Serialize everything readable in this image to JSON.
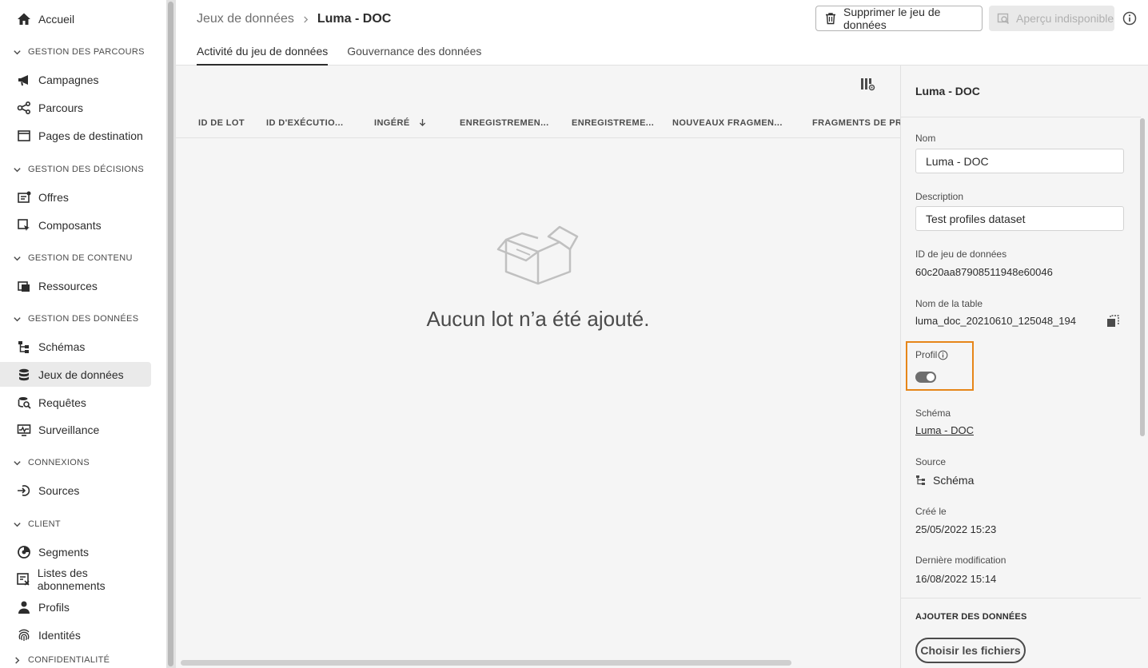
{
  "sidebar": {
    "home": "Accueil",
    "sections": {
      "journeys": "GESTION DES PARCOURS",
      "decisions": "GESTION DES DÉCISIONS",
      "content": "GESTION DE CONTENU",
      "data": "GESTION DES DONNÉES",
      "connections": "CONNEXIONS",
      "client": "CLIENT",
      "privacy": "CONFIDENTIALITÉ"
    },
    "items": {
      "campaigns": "Campagnes",
      "journeys": "Parcours",
      "landing_pages": "Pages de destination",
      "offers": "Offres",
      "components": "Composants",
      "resources": "Ressources",
      "schemas": "Schémas",
      "datasets": "Jeux de données",
      "queries": "Requêtes",
      "monitoring": "Surveillance",
      "sources": "Sources",
      "segments": "Segments",
      "subscription_lists": "Listes des abonnements",
      "profiles": "Profils",
      "identities": "Identités"
    }
  },
  "header": {
    "breadcrumb_parent": "Jeux de données",
    "breadcrumb_current": "Luma - DOC",
    "delete_button": "Supprimer le jeu de données",
    "preview_button": "Aperçu indisponible",
    "tabs": [
      "Activité du jeu de données",
      "Gouvernance des données"
    ]
  },
  "table": {
    "columns": [
      "ID DE LOT",
      "ID D'EXÉCUTIO...",
      "INGÉRÉ",
      "ENREGISTREMEN...",
      "ENREGISTREME...",
      "NOUVEAUX FRAGMEN...",
      "FRAGMENTS DE PRO"
    ],
    "sort_column": "INGÉRÉ",
    "sort_direction": "descending",
    "empty_message": "Aucun lot n’a été ajouté."
  },
  "panel": {
    "title": "Luma - DOC",
    "name_label": "Nom",
    "name_value": "Luma - DOC",
    "description_label": "Description",
    "description_value": "Test profiles dataset",
    "dataset_id_label": "ID de jeu de données",
    "dataset_id_value": "60c20aa87908511948e60046",
    "table_name_label": "Nom de la table",
    "table_name_value": "luma_doc_20210610_125048_194",
    "profile_label": "Profil",
    "profile_enabled": true,
    "schema_label": "Schéma",
    "schema_value": "Luma - DOC",
    "source_label": "Source",
    "source_value": "Schéma",
    "created_label": "Créé le",
    "created_value": "25/05/2022 15:23",
    "modified_label": "Dernière modification",
    "modified_value": "16/08/2022 15:14",
    "add_data_title": "AJOUTER DES DONNÉES",
    "choose_files_button": "Choisir les fichiers"
  },
  "colors": {
    "highlight_border": "#e68619",
    "active_item_bg": "#eaeaea",
    "panel_bg": "#f5f5f5"
  }
}
